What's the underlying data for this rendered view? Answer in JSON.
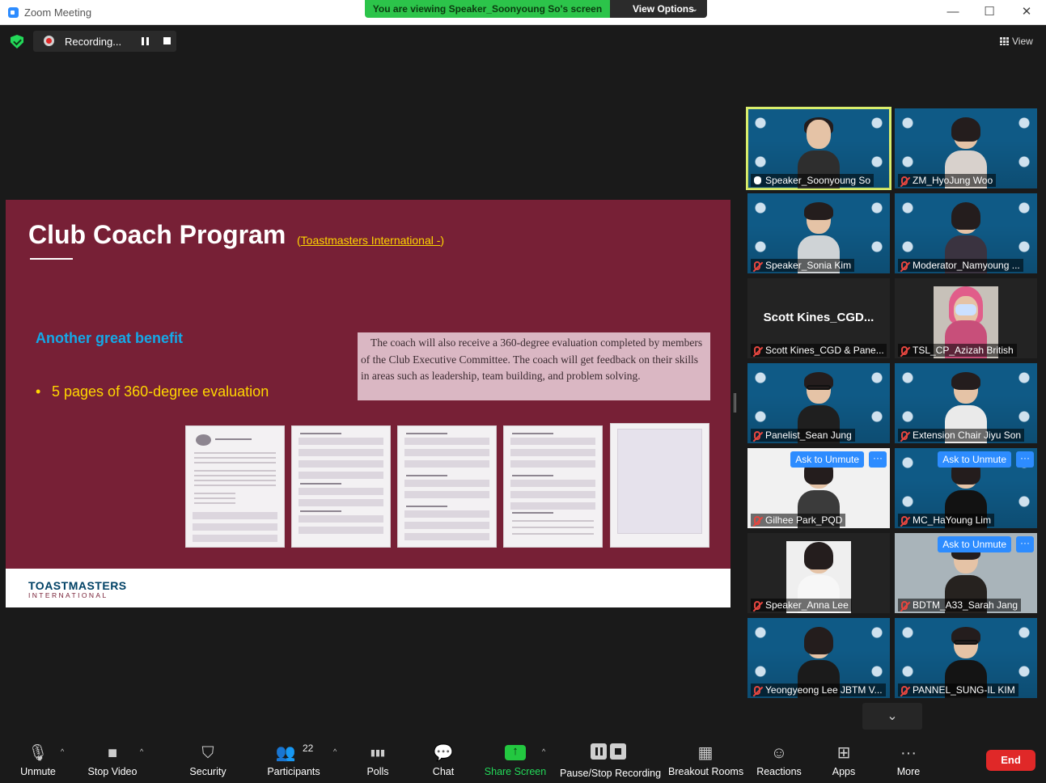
{
  "window": {
    "title": "Zoom Meeting",
    "min": "—",
    "max": "☐",
    "close": "✕"
  },
  "share_banner": {
    "text": "You are viewing Speaker_Soonyoung So's screen",
    "view_options": "View Options",
    "chevron": "⌄"
  },
  "recording": {
    "label": "Recording..."
  },
  "view_button": {
    "label": "View"
  },
  "slide": {
    "title": "Club Coach Program",
    "title_link_open": "(",
    "title_link": "Toastmasters International -",
    "title_link_close": ")",
    "heading": "Another great benefit",
    "bullet_dot": "•",
    "bullet": "5 pages of 360-degree evaluation",
    "description": "The coach will also receive a 360-degree evaluation completed by members of the Club Executive Committee. The coach will get feedback on their skills in areas such as leadership, team building, and problem solving.",
    "footer_logo": "TOASTMASTERS",
    "footer_logo_sub": "INTERNATIONAL"
  },
  "participants": [
    {
      "name": "Speaker_Soonyoung So",
      "state": "speaking",
      "video": "blue-backdrop"
    },
    {
      "name": "ZM_HyoJung Woo",
      "state": "muted",
      "video": "blue-backdrop"
    },
    {
      "name": "Speaker_Sonia Kim",
      "state": "muted",
      "video": "blue-backdrop"
    },
    {
      "name": "Moderator_Namyoung ...",
      "state": "muted",
      "video": "blue-backdrop"
    },
    {
      "name": "Scott Kines_CGD & Pane...",
      "center_name": "Scott  Kines_CGD...",
      "state": "muted",
      "video": "off"
    },
    {
      "name": "TSL_CP_Azizah British",
      "state": "muted",
      "video": "room"
    },
    {
      "name": "Panelist_Sean Jung",
      "state": "muted",
      "video": "blue-backdrop"
    },
    {
      "name": "Extension Chair Jiyu Son",
      "state": "muted",
      "video": "blue-backdrop"
    },
    {
      "name": "Gilhee Park_PQD",
      "state": "muted",
      "video": "white-backdrop",
      "ask_unmute": "Ask to Unmute"
    },
    {
      "name": "MC_HaYoung Lim",
      "state": "muted",
      "video": "blue-backdrop",
      "ask_unmute": "Ask to Unmute"
    },
    {
      "name": "Speaker_Anna Lee",
      "state": "muted",
      "video": "portrait"
    },
    {
      "name": "BDTM_A33_Sarah Jang",
      "state": "muted",
      "video": "room",
      "ask_unmute": "Ask to Unmute"
    },
    {
      "name": "Yeongyeong Lee JBTM V...",
      "state": "muted",
      "video": "blue-backdrop"
    },
    {
      "name": "PANNEL_SUNG-IL KIM",
      "state": "muted",
      "video": "blue-backdrop"
    }
  ],
  "toolbar": {
    "unmute": "Unmute",
    "stop_video": "Stop Video",
    "security": "Security",
    "participants": "Participants",
    "participant_count": "22",
    "polls": "Polls",
    "chat": "Chat",
    "share_screen": "Share Screen",
    "pause_stop_recording": "Pause/Stop Recording",
    "breakout_rooms": "Breakout Rooms",
    "reactions": "Reactions",
    "apps": "Apps",
    "more": "More",
    "end": "End"
  },
  "icons": {
    "caret": "^",
    "gallery_down": "⌄",
    "more_dots": "···",
    "mic": "🎙",
    "camera": "■",
    "security": "⛉",
    "people": "👥",
    "polls": "▮▮▮",
    "chat": "💬",
    "breakout": "▦",
    "reactions": "☺",
    "apps": "⊞",
    "more": "···"
  },
  "colors": {
    "share_banner": "#2cc44a",
    "slide_bg": "#772036",
    "accent_blue": "#2d8cff",
    "end_red": "#e02828",
    "active_speaker": "#d9ee6c"
  }
}
